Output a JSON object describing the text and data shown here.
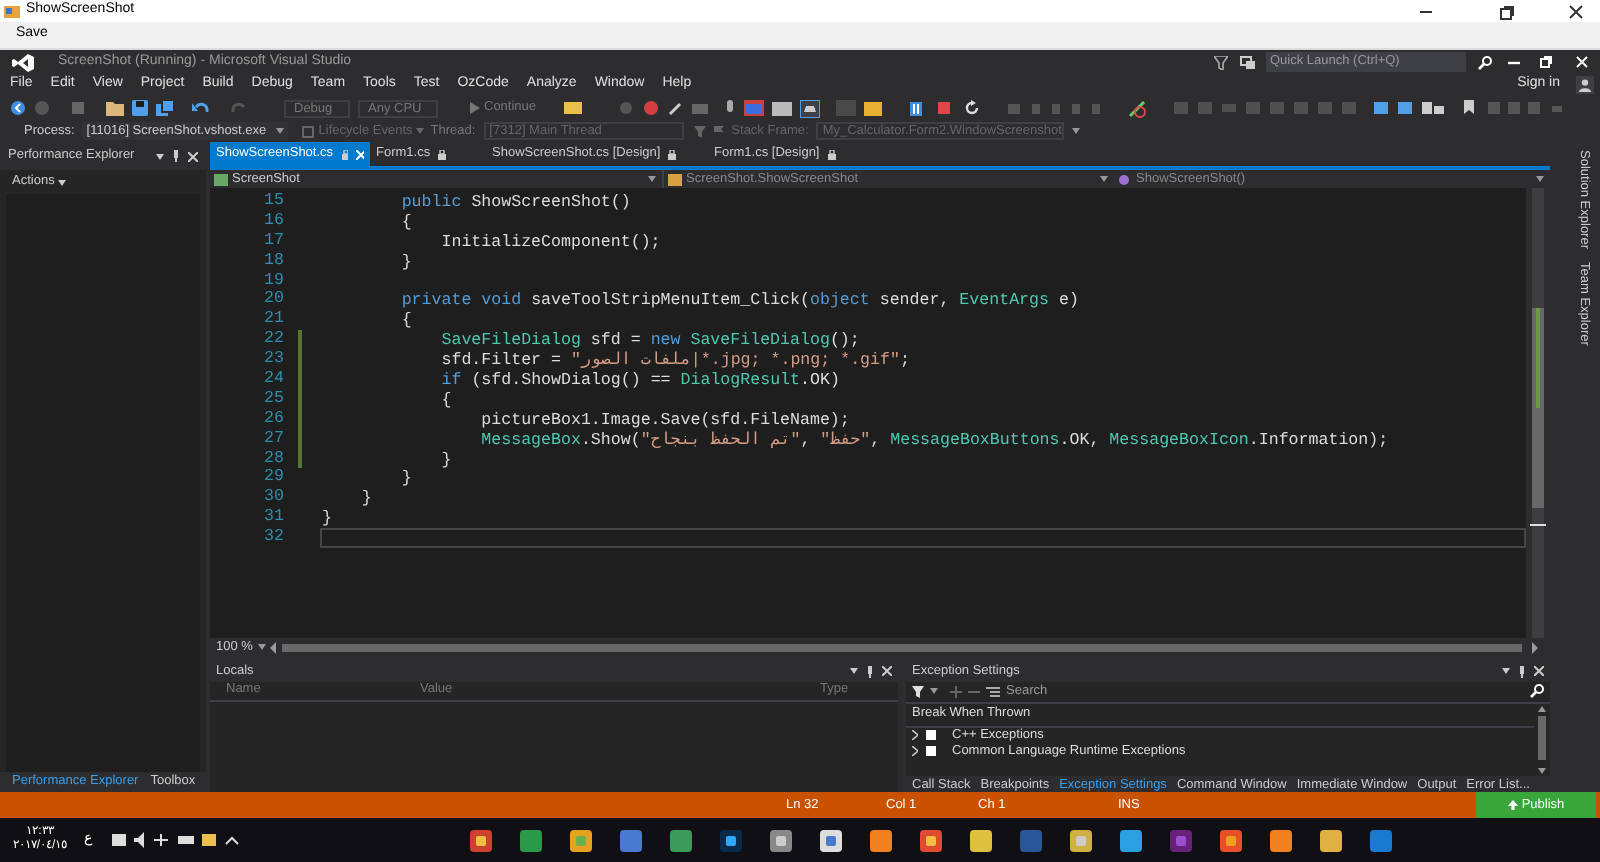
{
  "app_window": {
    "title": "ShowScreenShot",
    "menu": [
      "Save"
    ]
  },
  "vs": {
    "title": "ScreenShot (Running) - Microsoft Visual Studio",
    "quick_launch": {
      "placeholder": "Quick Launch (Ctrl+Q)"
    },
    "menu": [
      "File",
      "Edit",
      "View",
      "Project",
      "Build",
      "Debug",
      "Team",
      "Tools",
      "Test",
      "OzCode",
      "Analyze",
      "Window",
      "Help"
    ],
    "sign_in": "Sign in",
    "toolbar": {
      "configuration": "Debug",
      "platform": "Any CPU",
      "continue": "Continue"
    },
    "debug_location": {
      "process_label": "Process:",
      "process": "[11016] ScreenShot.vshost.exe",
      "lifecycle": "Lifecycle Events",
      "thread_label": "Thread:",
      "thread": "[7312] Main Thread",
      "stack_frame_label": "Stack Frame:",
      "stack_frame": "My_Calculator.Form2.WindowScreenshot"
    }
  },
  "left_panel": {
    "title": "Performance Explorer",
    "actions": "Actions",
    "tabs": [
      {
        "label": "Performance Explorer",
        "selected": true
      },
      {
        "label": "Toolbox",
        "selected": false
      }
    ]
  },
  "document_tabs": [
    {
      "label": "ShowScreenShot.cs",
      "selected": true
    },
    {
      "label": "Form1.cs",
      "selected": false
    },
    {
      "label": "ShowScreenShot.cs [Design]",
      "selected": false
    },
    {
      "label": "Form1.cs [Design]",
      "selected": false
    }
  ],
  "navigation_bar": {
    "project": "ScreenShot",
    "type": "ScreenShot.ShowScreenShot",
    "member": "ShowScreenShot()"
  },
  "code_lines": [
    {
      "number": "15",
      "changed": false,
      "current": false,
      "tokens": [
        {
          "text": "        public",
          "kind": "keyword"
        },
        {
          "text": " ShowScreenShot()",
          "kind": "plain"
        }
      ]
    },
    {
      "number": "16",
      "changed": false,
      "current": false,
      "tokens": [
        {
          "text": "        {",
          "kind": "plain"
        }
      ]
    },
    {
      "number": "17",
      "changed": false,
      "current": false,
      "tokens": [
        {
          "text": "            InitializeComponent();",
          "kind": "plain"
        }
      ]
    },
    {
      "number": "18",
      "changed": false,
      "current": false,
      "tokens": [
        {
          "text": "        }",
          "kind": "plain"
        }
      ]
    },
    {
      "number": "19",
      "changed": false,
      "current": false
    },
    {
      "number": "20",
      "changed": false,
      "current": false,
      "tokens": [
        {
          "text": "        private",
          "kind": "keyword"
        },
        {
          "text": " void",
          "kind": "keyword"
        },
        {
          "text": " saveToolStripMenuItem_Click(",
          "kind": "plain"
        },
        {
          "text": "object",
          "kind": "keyword"
        },
        {
          "text": " sender, ",
          "kind": "plain"
        },
        {
          "text": "EventArgs",
          "kind": "type"
        },
        {
          "text": " e)",
          "kind": "plain"
        }
      ]
    },
    {
      "number": "21",
      "changed": false,
      "current": false,
      "tokens": [
        {
          "text": "        {",
          "kind": "plain"
        }
      ]
    },
    {
      "number": "22",
      "changed": true,
      "current": false,
      "tokens": [
        {
          "text": "            SaveFileDialog",
          "kind": "type"
        },
        {
          "text": " sfd = ",
          "kind": "plain"
        },
        {
          "text": "new",
          "kind": "keyword"
        },
        {
          "text": " SaveFileDialog",
          "kind": "type"
        },
        {
          "text": "();",
          "kind": "plain"
        }
      ]
    },
    {
      "number": "23",
      "changed": true,
      "current": false,
      "tokens": [
        {
          "text": "            sfd.Filter = ",
          "kind": "plain"
        },
        {
          "text": "\"ملفات الصور|*.jpg; *.png; *.gif\"",
          "kind": "string"
        },
        {
          "text": ";",
          "kind": "plain"
        }
      ]
    },
    {
      "number": "24",
      "changed": true,
      "current": false,
      "tokens": [
        {
          "text": "            if",
          "kind": "keyword"
        },
        {
          "text": " (sfd.ShowDialog() == ",
          "kind": "plain"
        },
        {
          "text": "DialogResult",
          "kind": "type"
        },
        {
          "text": ".OK)",
          "kind": "plain"
        }
      ]
    },
    {
      "number": "25",
      "changed": true,
      "current": false,
      "tokens": [
        {
          "text": "            {",
          "kind": "plain"
        }
      ]
    },
    {
      "number": "26",
      "changed": true,
      "current": false,
      "tokens": [
        {
          "text": "                pictureBox1.Image.Save(sfd.FileName);",
          "kind": "plain"
        }
      ]
    },
    {
      "number": "27",
      "changed": true,
      "current": false,
      "tokens": [
        {
          "text": "                MessageBox",
          "kind": "type"
        },
        {
          "text": ".Show(",
          "kind": "plain"
        },
        {
          "text": "\"تم الحفظ بنجاح\"",
          "kind": "string"
        },
        {
          "text": ", ",
          "kind": "plain"
        },
        {
          "text": "\"حفظ\"",
          "kind": "string"
        },
        {
          "text": ", ",
          "kind": "plain"
        },
        {
          "text": "MessageBoxButtons",
          "kind": "type"
        },
        {
          "text": ".OK, ",
          "kind": "plain"
        },
        {
          "text": "MessageBoxIcon",
          "kind": "type"
        },
        {
          "text": ".Information);",
          "kind": "plain"
        }
      ]
    },
    {
      "number": "28",
      "changed": true,
      "current": false,
      "tokens": [
        {
          "text": "            }",
          "kind": "plain"
        }
      ]
    },
    {
      "number": "29",
      "changed": false,
      "current": false,
      "tokens": [
        {
          "text": "        }",
          "kind": "plain"
        }
      ]
    },
    {
      "number": "30",
      "changed": false,
      "current": false,
      "tokens": [
        {
          "text": "    }",
          "kind": "plain"
        }
      ]
    },
    {
      "number": "31",
      "changed": false,
      "current": false,
      "tokens": [
        {
          "text": "}",
          "kind": "plain"
        }
      ]
    },
    {
      "number": "32",
      "changed": false,
      "current": true
    }
  ],
  "zoom": "100 %",
  "locals": {
    "title": "Locals",
    "columns": [
      "Name",
      "Value",
      "Type"
    ]
  },
  "exception_settings": {
    "title": "Exception Settings",
    "search": {
      "placeholder": "Search"
    },
    "header": "Break When Thrown",
    "items": [
      {
        "label": "C++ Exceptions",
        "checked": false
      },
      {
        "label": "Common Language Runtime Exceptions",
        "checked": false
      }
    ]
  },
  "bottom_tabs": [
    {
      "label": "Call Stack",
      "selected": false
    },
    {
      "label": "Breakpoints",
      "selected": false
    },
    {
      "label": "Exception Settings",
      "selected": true
    },
    {
      "label": "Command Window",
      "selected": false
    },
    {
      "label": "Immediate Window",
      "selected": false
    },
    {
      "label": "Output",
      "selected": false
    },
    {
      "label": "Error List...",
      "selected": false
    }
  ],
  "side_tabs": [
    "Solution Explorer",
    "Team Explorer"
  ],
  "status_bar": {
    "line": "Ln 32",
    "column": "Col 1",
    "char": "Ch 1",
    "mode": "INS",
    "publish": "Publish"
  },
  "taskbar": {
    "time": "١٢:٣٣",
    "date": "٢٠١٧/٠٤/١٥",
    "language": "ع"
  }
}
